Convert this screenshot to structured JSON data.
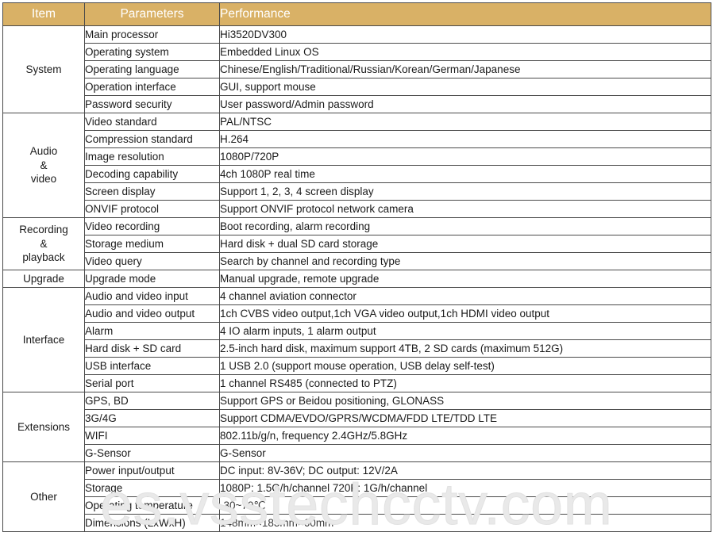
{
  "watermark": {
    "text": "es.vsstechcctv.com"
  },
  "colors": {
    "header_bg": "#d9b166",
    "header_text": "#ffffff",
    "border": "#4a4a4a",
    "body_text": "#1a1a1a",
    "watermark": "#e9e9e9"
  },
  "table": {
    "headers": {
      "item": "Item",
      "parameters": "Parameters",
      "performance": "Performance"
    },
    "groups": [
      {
        "item": "System",
        "rows": [
          {
            "parameter": "Main processor",
            "performance": "Hi3520DV300"
          },
          {
            "parameter": "Operating system",
            "performance": "Embedded Linux OS"
          },
          {
            "parameter": "Operating language",
            "performance": "Chinese/English/Traditional/Russian/Korean/German/Japanese"
          },
          {
            "parameter": "Operation interface",
            "performance": "GUI, support mouse"
          },
          {
            "parameter": "Password security",
            "performance": "User password/Admin password"
          }
        ]
      },
      {
        "item": "Audio\n&\nvideo",
        "rows": [
          {
            "parameter": "Video standard",
            "performance": "PAL/NTSC"
          },
          {
            "parameter": "Compression standard",
            "performance": "H.264"
          },
          {
            "parameter": "Image resolution",
            "performance": "1080P/720P"
          },
          {
            "parameter": "Decoding capability",
            "performance": "4ch 1080P real time"
          },
          {
            "parameter": "Screen display",
            "performance": "Support 1, 2, 3, 4 screen display"
          },
          {
            "parameter": "ONVIF protocol",
            "performance": "Support ONVIF protocol network camera"
          }
        ]
      },
      {
        "item": "Recording\n&\nplayback",
        "rows": [
          {
            "parameter": "Video recording",
            "performance": "Boot recording, alarm recording"
          },
          {
            "parameter": "Storage medium",
            "performance": "Hard disk + dual SD card storage"
          },
          {
            "parameter": "Video query",
            "performance": "Search by channel and recording type"
          }
        ]
      },
      {
        "item": "Upgrade",
        "rows": [
          {
            "parameter": "Upgrade mode",
            "performance": "Manual upgrade, remote upgrade"
          }
        ]
      },
      {
        "item": "Interface",
        "rows": [
          {
            "parameter": "Audio and video input",
            "performance": "4 channel aviation connector"
          },
          {
            "parameter": "Audio and video output",
            "performance": "1ch CVBS video output,1ch VGA video output,1ch HDMI video output"
          },
          {
            "parameter": "Alarm",
            "performance": "4 IO alarm inputs, 1 alarm output"
          },
          {
            "parameter": "Hard disk + SD card",
            "performance": "2.5-inch hard disk, maximum support 4TB, 2 SD cards (maximum 512G)"
          },
          {
            "parameter": "USB interface",
            "performance": "1 USB 2.0 (support mouse operation, USB delay self-test)"
          },
          {
            "parameter": "Serial port",
            "performance": "1 channel RS485 (connected to PTZ)"
          }
        ]
      },
      {
        "item": "Extensions",
        "rows": [
          {
            "parameter": "GPS, BD",
            "performance": "Support GPS or Beidou positioning, GLONASS"
          },
          {
            "parameter": "3G/4G",
            "performance": "Support CDMA/EVDO/GPRS/WCDMA/FDD LTE/TDD LTE"
          },
          {
            "parameter": "WIFI",
            "performance": "802.11b/g/n, frequency 2.4GHz/5.8GHz"
          },
          {
            "parameter": "G-Sensor",
            "performance": "G-Sensor"
          }
        ]
      },
      {
        "item": "Other",
        "rows": [
          {
            "parameter": "Power input/output",
            "performance": "DC input: 8V-36V; DC output: 12V/2A"
          },
          {
            "parameter": "Storage",
            "performance": "1080P: 1.5G/h/channel  720P: 1G/h/channel"
          },
          {
            "parameter": "Operating temperature",
            "performance": "-30~70℃"
          },
          {
            "parameter": "Dimensions (LxWxH)",
            "performance": "148mm×183mm×60mm"
          }
        ]
      }
    ]
  }
}
